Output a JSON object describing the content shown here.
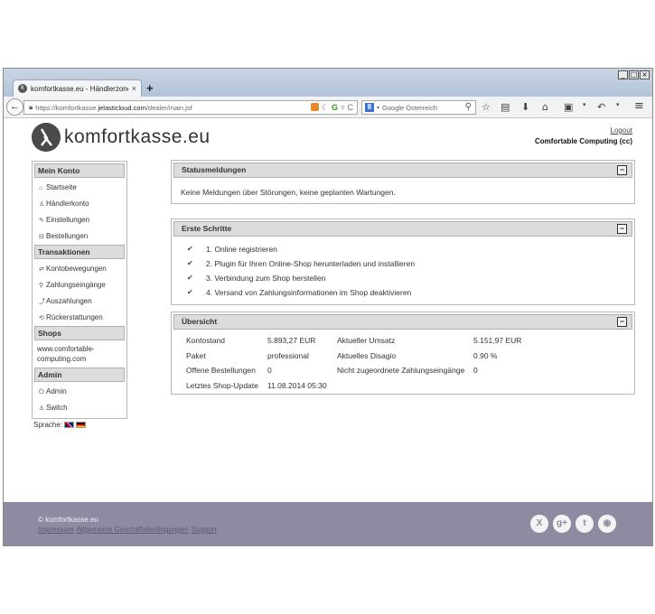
{
  "browser": {
    "tab_title": "komfortkasse.eu - Händlerzone",
    "tab_close": "×",
    "new_tab": "+",
    "url_prefix": "https://komfortkasse.",
    "url_domain": "jelasticloud.com",
    "url_path": "/dealer/main.jsf",
    "search_placeholder": "Google Österreich",
    "window_buttons": [
      "_",
      "□",
      "×"
    ]
  },
  "header": {
    "logo_text": "komfortkasse.eu",
    "logout": "Logout",
    "company": "Comfortable Computing (cc)"
  },
  "sidebar": {
    "sections": [
      {
        "title": "Mein Konto",
        "items": [
          {
            "icon": "home-icon",
            "glyph": "⌂",
            "label": "Startseite"
          },
          {
            "icon": "user-icon",
            "glyph": "♙",
            "label": "Händlerkonto"
          },
          {
            "icon": "wrench-icon",
            "glyph": "✎",
            "label": "Einstellungen"
          },
          {
            "icon": "cart-icon",
            "glyph": "⊟",
            "label": "Bestellungen"
          }
        ]
      },
      {
        "title": "Transaktionen",
        "items": [
          {
            "icon": "arrows-icon",
            "glyph": "⇄",
            "label": "Kontobewegungen"
          },
          {
            "icon": "search-icon",
            "glyph": "⚲",
            "label": "Zahlungseingänge"
          },
          {
            "icon": "payout-icon",
            "glyph": "⤴",
            "label": "Auszahlungen"
          },
          {
            "icon": "refund-icon",
            "glyph": "⟲",
            "label": "Rückerstattungen"
          }
        ]
      },
      {
        "title": "Shops",
        "shop": "www.comfortable-computing.com"
      },
      {
        "title": "Admin",
        "items": [
          {
            "icon": "power-icon",
            "glyph": "⏻",
            "label": "Admin"
          },
          {
            "icon": "user-icon",
            "glyph": "♙",
            "label": "Switch"
          }
        ]
      }
    ],
    "language_label": "Sprache:"
  },
  "status": {
    "title": "Statusmeldungen",
    "collapse": "−",
    "message": "Keine Meldungen über Störungen, keine geplanten Wartungen."
  },
  "steps": {
    "title": "Erste Schritte",
    "collapse": "−",
    "items": [
      "1. Online registrieren",
      "2. Plugin für Ihren Online-Shop herunterladen und installieren",
      "3. Verbindung zum Shop herstellen",
      "4. Versand von Zahlungsinformationen im Shop deaktivieren"
    ]
  },
  "overview": {
    "title": "Übersicht",
    "collapse": "−",
    "rows": [
      [
        "Kontostand",
        "5.893,27 EUR",
        "Aktueller Umsatz",
        "5.151,97 EUR"
      ],
      [
        "Paket",
        "professional",
        "Aktuelles Disagio",
        "0.90 %"
      ],
      [
        "Offene Bestellungen",
        "0",
        "Nicht zugeordnete Zahlungseingänge",
        "0"
      ],
      [
        "Letztes Shop-Update",
        "11.08.2014 05:30",
        "",
        ""
      ]
    ]
  },
  "footer": {
    "copyright": "© komfortkasse.eu",
    "links": [
      "Impressum",
      "Allgemeine Geschäftsbedingungen",
      "Support"
    ],
    "social": [
      {
        "name": "xing-icon",
        "glyph": "X"
      },
      {
        "name": "google-plus-icon",
        "glyph": "g+"
      },
      {
        "name": "twitter-icon",
        "glyph": "t"
      },
      {
        "name": "rss-icon",
        "glyph": "◉"
      }
    ]
  }
}
